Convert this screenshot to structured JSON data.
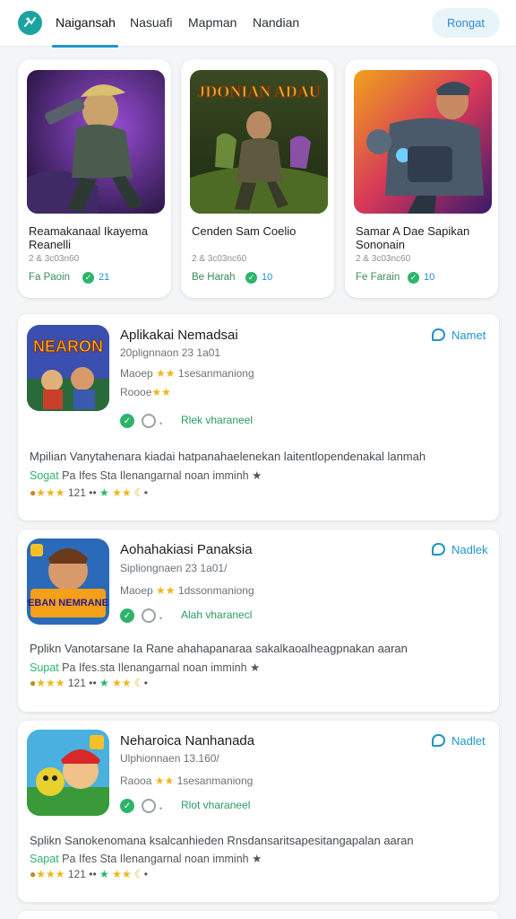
{
  "header": {
    "tabs": [
      "Naigansah",
      "Nasuafi",
      "Mapman",
      "Nandian"
    ],
    "login_label": "Rongat"
  },
  "featured": [
    {
      "title": "Reamakanaal Ikayema Reanelli",
      "subtitle": "2 & 3c03n60",
      "by": "Fa Paoin",
      "count": "21",
      "art_title": ""
    },
    {
      "title": "Cenden Sam Coelio",
      "subtitle": "2 & 3c03nc60",
      "by": "Be Harah",
      "count": "10",
      "art_title": "JDONIAN ADAU"
    },
    {
      "title": "Samar A Dae Sapikan Sononain",
      "subtitle": "2 & 3c03nc60",
      "by": "Fe Farain",
      "count": "10",
      "art_title": ""
    }
  ],
  "apps": [
    {
      "name": "Aplikakai Nemadsai",
      "meta": "20plignnaon 23 1a01",
      "rating_text": "Maoep",
      "rating_suffix": "1sesanmaniong",
      "extra_label": "Roooe",
      "status": "Rlek vharaneel",
      "action": "Namet",
      "icon_title": "NEARON",
      "description": "Mpilian Vanytahenara kiadai hatpanahaelenekan laitentlopendenakal lanmah",
      "tag_prefix": "Sogat",
      "tag_text": "Pa Ifes Sta Ilenangarnal noan imminh",
      "stats_num": "121"
    },
    {
      "name": "Aohahakiasi Panaksia",
      "meta": "Sipliongnaen 23 1a01/",
      "rating_text": "Maoep",
      "rating_suffix": "1dssonmaniong",
      "extra_label": "",
      "status": "Alah vharanecl",
      "action": "Nadlek",
      "icon_title": "PEBAN NEMRANES",
      "description": "Pplikn Vanotarsane Ia Rane ahahapanaraa sakalkaoalheagpnakan aaran",
      "tag_prefix": "Supat",
      "tag_text": "Pa Ifes.sta Ilenangarnal noan imminh",
      "stats_num": "121"
    },
    {
      "name": "Neharoica Nanhanada",
      "meta": "Ulphionnaen 13.160/",
      "rating_text": "Raooa",
      "rating_suffix": "1sesanmaniong",
      "extra_label": "",
      "status": "Rlot vharaneel",
      "action": "Nadlet",
      "icon_title": "",
      "description": "Splikn Sanokenomana ksalcanhieden Rnsdansaritsapesitangapalan aaran",
      "tag_prefix": "Sapat",
      "tag_text": "Pa Ifes Sta Ilenangarnal noan imminh",
      "stats_num": "121"
    }
  ],
  "colors": {
    "accent": "#1f95c9",
    "green": "#2db46b",
    "star": "#f0b41d"
  }
}
